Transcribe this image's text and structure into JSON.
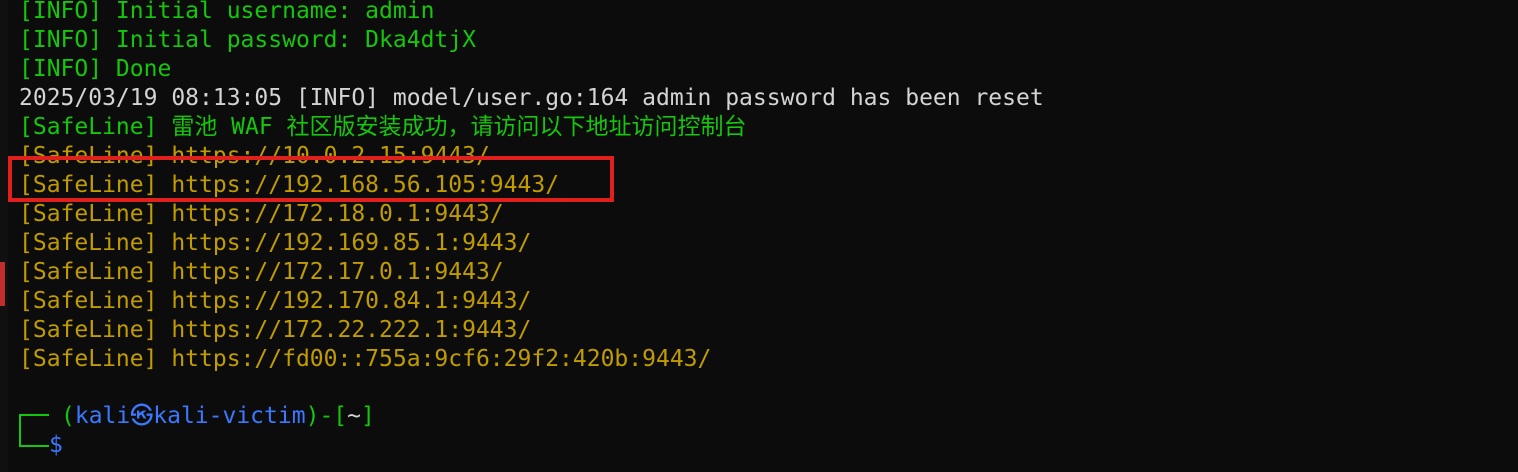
{
  "log_lines": [
    {
      "text": "[INFO] Initial username: admin",
      "color": "#16c60c"
    },
    {
      "text": "[INFO] Initial password: Dka4dtjX",
      "color": "#16c60c"
    },
    {
      "text": "[INFO] Done",
      "color": "#16c60c"
    },
    {
      "text": "2025/03/19 08:13:05 [INFO] model/user.go:164 admin password has been reset",
      "color": "#d4d4d4"
    },
    {
      "text": "[SafeLine] 雷池 WAF 社区版安装成功，请访问以下地址访问控制台",
      "color": "#16c60c"
    },
    {
      "text": "[SafeLine] https://10.0.2.15:9443/",
      "color": "#c19c00"
    },
    {
      "text": "[SafeLine] https://192.168.56.105:9443/",
      "color": "#c19c00"
    },
    {
      "text": "[SafeLine] https://172.18.0.1:9443/",
      "color": "#c19c00"
    },
    {
      "text": "[SafeLine] https://192.169.85.1:9443/",
      "color": "#c19c00"
    },
    {
      "text": "[SafeLine] https://172.17.0.1:9443/",
      "color": "#c19c00"
    },
    {
      "text": "[SafeLine] https://192.170.84.1:9443/",
      "color": "#c19c00"
    },
    {
      "text": "[SafeLine] https://172.22.222.1:9443/",
      "color": "#c19c00"
    },
    {
      "text": "[SafeLine] https://fd00::755a:9cf6:29f2:420b:9443/",
      "color": "#c19c00"
    }
  ],
  "prompt": {
    "open_paren": "(",
    "user": "kali",
    "at_symbol": "㉿",
    "host": "kali-victim",
    "close_paren": ")",
    "dash": "-",
    "open_bracket": "[",
    "cwd": "~",
    "close_bracket": "]",
    "symbol": "$"
  },
  "highlight": {
    "target_line": "[SafeLine] https://192.168.56.105:9443/",
    "color": "#e0201c"
  }
}
